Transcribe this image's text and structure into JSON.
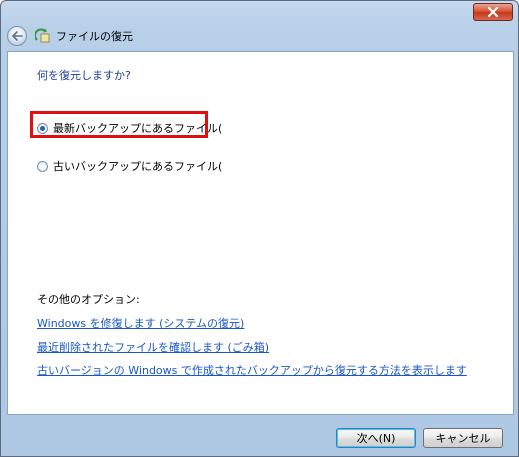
{
  "window": {
    "title": "ファイルの復元",
    "close_icon": "close-x-icon",
    "back_icon": "back-arrow-icon",
    "app_icon": "file-restore-icon"
  },
  "content": {
    "question": "何を復元しますか?",
    "options": [
      {
        "label": "最新バックアップにあるファイル(",
        "selected": true
      },
      {
        "label": "古いバックアップにあるファイル(",
        "selected": false
      }
    ],
    "other_title": "その他のオプション:",
    "links": [
      "Windows を修復します (システムの復元)",
      "最近削除されたファイルを確認します (ごみ箱)",
      "古いバージョンの Windows で作成されたバックアップから復元する方法を表示します"
    ]
  },
  "footer": {
    "next_label": "次へ(N)",
    "cancel_label": "キャンセル"
  },
  "colors": {
    "highlight": "#e01010",
    "link": "#1a56c6",
    "heading": "#1f3f8c"
  }
}
